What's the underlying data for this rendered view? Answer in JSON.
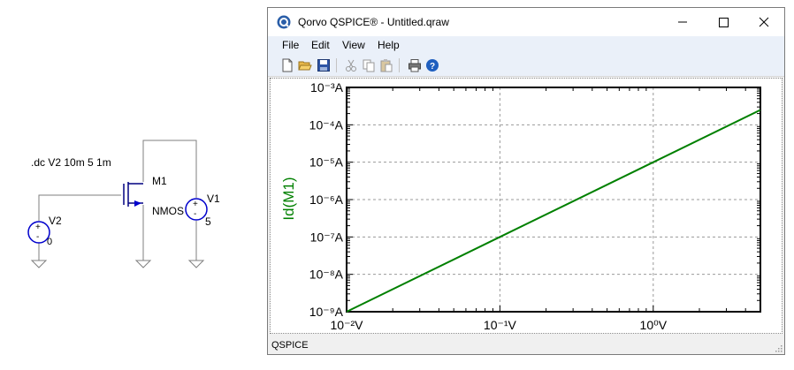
{
  "schematic": {
    "directive": ".dc V2 10m 5 1m",
    "m1_name": "M1",
    "m1_model": "NMOS",
    "v1_name": "V1",
    "v1_value": "5",
    "v2_name": "V2",
    "v2_value": "0",
    "plus": "+",
    "minus": "-"
  },
  "window": {
    "title": "Qorvo QSPICE® - Untitled.qraw",
    "menu": [
      "File",
      "Edit",
      "View",
      "Help"
    ],
    "toolbar_icons": [
      "new-file-icon",
      "open-folder-icon",
      "save-icon",
      "cut-icon",
      "copy-icon",
      "paste-icon",
      "print-icon",
      "help-icon"
    ],
    "status": "QSPICE"
  },
  "colors": {
    "trace": "#008000",
    "axis_label": "#008000",
    "grid": "#9a9a9a",
    "window_frame": "#7a7a7a"
  },
  "chart_data": {
    "type": "line",
    "x_scale": "log",
    "y_scale": "log",
    "xlim": [
      0.01,
      5
    ],
    "ylim": [
      1e-09,
      0.001
    ],
    "grid": true,
    "ylabel": "Id(M1)",
    "x_tick_values": [
      0.01,
      0.1,
      1
    ],
    "x_tick_labels": [
      "10⁻²V",
      "10⁻¹V",
      "10⁰V"
    ],
    "y_tick_values": [
      0.001,
      0.0001,
      1e-05,
      1e-06,
      1e-07,
      1e-08,
      1e-09
    ],
    "y_tick_labels": [
      "10⁻³A",
      "10⁻⁴A",
      "10⁻⁵A",
      "10⁻⁶A",
      "10⁻⁷A",
      "10⁻⁸A",
      "10⁻⁹A"
    ],
    "series": [
      {
        "x": [
          0.01,
          0.1,
          1,
          5
        ],
        "y": [
          1e-09,
          1e-07,
          1e-05,
          0.00025
        ]
      }
    ]
  }
}
